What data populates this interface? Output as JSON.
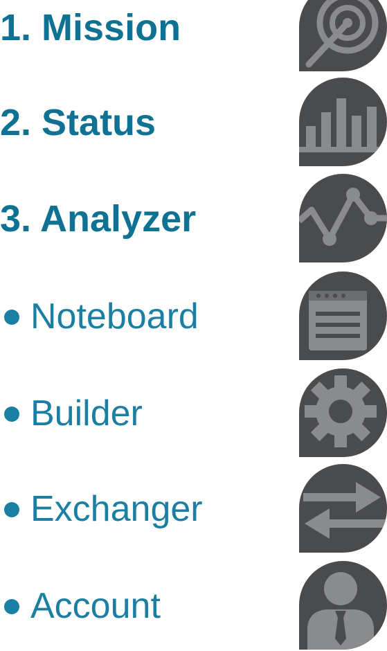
{
  "menu": {
    "items": [
      {
        "label": "1. Mission",
        "icon": "target-icon",
        "style": "primary"
      },
      {
        "label": "2. Status",
        "icon": "bar-chart-icon",
        "style": "primary"
      },
      {
        "label": "3. Analyzer",
        "icon": "pulse-graph-icon",
        "style": "primary"
      },
      {
        "label": "Noteboard",
        "icon": "notepad-icon",
        "style": "secondary"
      },
      {
        "label": "Builder",
        "icon": "gear-icon",
        "style": "secondary"
      },
      {
        "label": "Exchanger",
        "icon": "exchange-arrows-icon",
        "style": "secondary"
      },
      {
        "label": "Account",
        "icon": "user-account-icon",
        "style": "secondary"
      }
    ]
  },
  "colors": {
    "label_text": "#0f7293",
    "icon_tile": "#4a4b4d",
    "icon_glyph": "#8a8b8d"
  }
}
